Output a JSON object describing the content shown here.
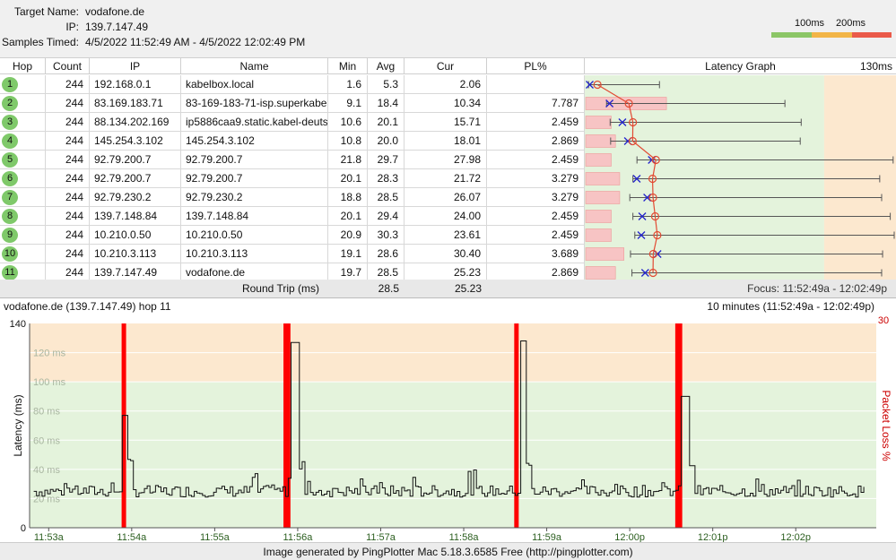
{
  "header": {
    "target_label": "Target Name:",
    "target_value": "vodafone.de",
    "ip_label": "IP:",
    "ip_value": "139.7.147.49",
    "samples_label": "Samples Timed:",
    "samples_value": "4/5/2022 11:52:49 AM - 4/5/2022 12:02:49 PM",
    "legend_100": "100ms",
    "legend_200": "200ms",
    "legend_colors": [
      "#8cc667",
      "#f2b548",
      "#ea5a4a"
    ]
  },
  "table": {
    "columns": [
      "Hop",
      "Count",
      "IP",
      "Name",
      "Min",
      "Avg",
      "Cur",
      "PL%",
      "Latency Graph"
    ],
    "graph_max_label": "130ms",
    "rows": [
      {
        "hop": "1",
        "count": "244",
        "ip": "192.168.0.1",
        "name": "kabelbox.local",
        "min": "1.6",
        "avg": "5.3",
        "cur": "2.06",
        "pl": ""
      },
      {
        "hop": "2",
        "count": "244",
        "ip": "83.169.183.71",
        "name": "83-169-183-71-isp.superkabel",
        "min": "9.1",
        "avg": "18.4",
        "cur": "10.34",
        "pl": "7.787"
      },
      {
        "hop": "3",
        "count": "244",
        "ip": "88.134.202.169",
        "name": "ip5886caa9.static.kabel-deuts",
        "min": "10.6",
        "avg": "20.1",
        "cur": "15.71",
        "pl": "2.459"
      },
      {
        "hop": "4",
        "count": "244",
        "ip": "145.254.3.102",
        "name": "145.254.3.102",
        "min": "10.8",
        "avg": "20.0",
        "cur": "18.01",
        "pl": "2.869"
      },
      {
        "hop": "5",
        "count": "244",
        "ip": "92.79.200.7",
        "name": "92.79.200.7",
        "min": "21.8",
        "avg": "29.7",
        "cur": "27.98",
        "pl": "2.459"
      },
      {
        "hop": "6",
        "count": "244",
        "ip": "92.79.200.7",
        "name": "92.79.200.7",
        "min": "20.1",
        "avg": "28.3",
        "cur": "21.72",
        "pl": "3.279"
      },
      {
        "hop": "7",
        "count": "244",
        "ip": "92.79.230.2",
        "name": "92.79.230.2",
        "min": "18.8",
        "avg": "28.5",
        "cur": "26.07",
        "pl": "3.279"
      },
      {
        "hop": "8",
        "count": "244",
        "ip": "139.7.148.84",
        "name": "139.7.148.84",
        "min": "20.1",
        "avg": "29.4",
        "cur": "24.00",
        "pl": "2.459"
      },
      {
        "hop": "9",
        "count": "244",
        "ip": "10.210.0.50",
        "name": "10.210.0.50",
        "min": "20.9",
        "avg": "30.3",
        "cur": "23.61",
        "pl": "2.459"
      },
      {
        "hop": "10",
        "count": "244",
        "ip": "10.210.3.113",
        "name": "10.210.3.113",
        "min": "19.1",
        "avg": "28.6",
        "cur": "30.40",
        "pl": "3.689"
      },
      {
        "hop": "11",
        "count": "244",
        "ip": "139.7.147.49",
        "name": "vodafone.de",
        "min": "19.7",
        "avg": "28.5",
        "cur": "25.23",
        "pl": "2.869"
      }
    ],
    "round_trip_label": "Round Trip (ms)",
    "round_trip_avg": "28.5",
    "round_trip_cur": "25.23",
    "focus_label": "Focus: 11:52:49a - 12:02:49p"
  },
  "chart_data": {
    "type": "line",
    "title": "vodafone.de (139.7.147.49) hop 11",
    "range_label": "10 minutes (11:52:49a - 12:02:49p)",
    "ylabel": "Latency (ms)",
    "y2label": "Packet Loss %",
    "ylim": [
      0,
      140
    ],
    "y_ticks": [
      "0",
      "140"
    ],
    "y_gridlabels": [
      "20 ms",
      "40 ms",
      "60 ms",
      "80 ms",
      "100 ms",
      "120 ms"
    ],
    "y2_max": "30",
    "x_ticks": [
      "11:53a",
      "11:54a",
      "11:55a",
      "11:56a",
      "11:57a",
      "11:58a",
      "11:59a",
      "12:00p",
      "12:01p",
      "12:02p"
    ],
    "zones": [
      {
        "from": 0,
        "to": 100,
        "color": "#e4f3dc"
      },
      {
        "from": 100,
        "to": 140,
        "color": "#fce8cf"
      }
    ],
    "loss_color": "#ff0000",
    "packet_loss_minutes": [
      1.08,
      3.03,
      3.06,
      5.81,
      7.75,
      7.78
    ],
    "spikes": [
      {
        "minute": 1.05,
        "ms": 77
      },
      {
        "minute": 3.1,
        "ms": 127
      },
      {
        "minute": 5.85,
        "ms": 128
      },
      {
        "minute": 7.8,
        "ms": 90
      }
    ],
    "baseline_ms": 25
  },
  "footer": {
    "text": "Image generated by PingPlotter Mac 5.18.3.6585 Free (http://pingplotter.com)"
  }
}
